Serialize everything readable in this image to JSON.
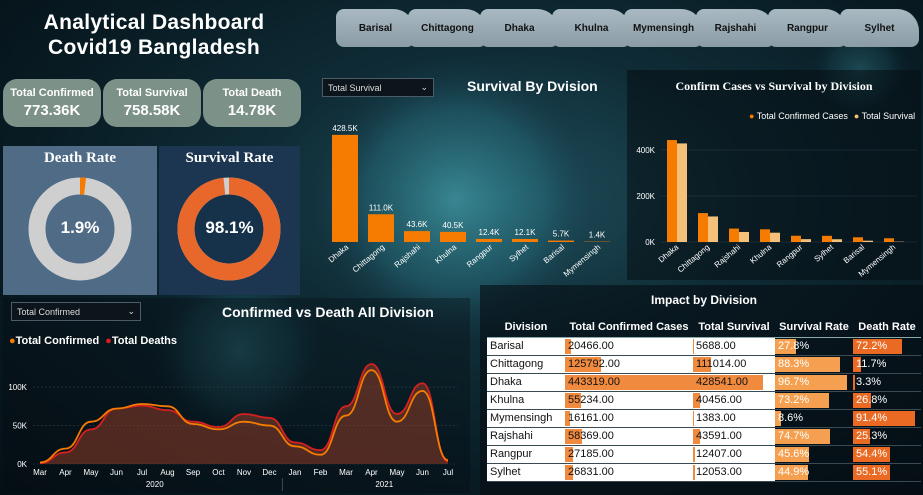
{
  "title": {
    "line1": "Analytical Dashboard",
    "line2": "Covid19 Bangladesh"
  },
  "tabs": [
    "Barisal",
    "Chittagong",
    "Dhaka",
    "Khulna",
    "Mymensingh",
    "Rajshahi",
    "Rangpur",
    "Sylhet"
  ],
  "kpis": [
    {
      "label": "Total Confirmed",
      "value": "773.36K"
    },
    {
      "label": "Total Survival",
      "value": "758.58K"
    },
    {
      "label": "Total Death",
      "value": "14.78K"
    }
  ],
  "gauges": [
    {
      "title": "Death Rate",
      "value": "1.9%",
      "fraction": 0.019
    },
    {
      "title": "Survival Rate",
      "value": "98.1%",
      "fraction": 0.981
    }
  ],
  "colors": {
    "orange": "#f57c00",
    "light_orange": "#f5c07a",
    "red": "#d62020",
    "gauge_bg": "#cfcfcf"
  },
  "survival_chart": {
    "slicer": "Total Survival",
    "title": "Survival By Dvision",
    "chart_data": {
      "type": "bar",
      "categories": [
        "Dhaka",
        "Chittagong",
        "Rajshahi",
        "Khulna",
        "Rangpur",
        "Sylhet",
        "Barisal",
        "Mymensingh"
      ],
      "values": [
        428.5,
        111.0,
        43.6,
        40.5,
        12.4,
        12.1,
        5.7,
        1.4
      ],
      "labels": [
        "428.5K",
        "111.0K",
        "43.6K",
        "40.5K",
        "12.4K",
        "12.1K",
        "5.7K",
        "1.4K"
      ],
      "ylim": [
        0,
        440
      ]
    }
  },
  "confirm_survival_chart": {
    "title": "Confirm Cases vs Survival by Division",
    "chart_data": {
      "type": "bar",
      "categories": [
        "Dhaka",
        "Chittagong",
        "Rajshahi",
        "Khulna",
        "Rangpur",
        "Sylhet",
        "Barisal",
        "Mymensingh"
      ],
      "series": [
        {
          "name": "Total Confirmed Cases",
          "values": [
            443319,
            125792,
            58369,
            55234,
            27185,
            26831,
            20466,
            16161
          ]
        },
        {
          "name": "Total Survival",
          "values": [
            428541,
            111014,
            43591,
            40456,
            12407,
            12053,
            5688,
            1383
          ]
        }
      ],
      "yticks": [
        "0K",
        "200K",
        "400K"
      ],
      "ylim": [
        0,
        500000
      ]
    }
  },
  "line_chart": {
    "slicer": "Total Confirmed",
    "title": "Confirmed vs Death All Division",
    "chart_data": {
      "type": "line",
      "x": [
        "Mar",
        "Apr",
        "May",
        "Jun",
        "Jul",
        "Aug",
        "Sep",
        "Oct",
        "Nov",
        "Dec",
        "Jan",
        "Feb",
        "Mar",
        "Apr",
        "May",
        "Jun",
        "Jul"
      ],
      "year_labels": [
        "2020",
        "2021"
      ],
      "yticks": [
        "0K",
        "50K",
        "100K"
      ],
      "ylim": [
        0,
        130000
      ],
      "series": [
        {
          "name": "Total Confirmed",
          "values": [
            2000,
            20000,
            55000,
            72000,
            78000,
            75000,
            52000,
            45000,
            55000,
            50000,
            23000,
            12000,
            63000,
            122000,
            55000,
            95000,
            5000
          ]
        },
        {
          "name": "Total Deaths",
          "values": [
            1000,
            15000,
            45000,
            72000,
            76000,
            70000,
            55000,
            48000,
            65000,
            60000,
            28000,
            18000,
            75000,
            130000,
            65000,
            105000,
            3000
          ]
        }
      ]
    }
  },
  "impact_table": {
    "title": "Impact by Division",
    "headers": [
      "Division",
      "Total Confirmed Cases",
      "Total Survival",
      "Survival Rate",
      "Death Rate"
    ],
    "rows": [
      {
        "division": "Barisal",
        "confirmed": "20466.00",
        "survival": "5688.00",
        "survival_rate": "27.8%",
        "death_rate": "72.2%",
        "c": 20466,
        "s": 5688,
        "sr": 27.8,
        "dr": 72.2
      },
      {
        "division": "Chittagong",
        "confirmed": "125792.00",
        "survival": "111014.00",
        "survival_rate": "88.3%",
        "death_rate": "11.7%",
        "c": 125792,
        "s": 111014,
        "sr": 88.3,
        "dr": 11.7
      },
      {
        "division": "Dhaka",
        "confirmed": "443319.00",
        "survival": "428541.00",
        "survival_rate": "96.7%",
        "death_rate": "3.3%",
        "c": 443319,
        "s": 428541,
        "sr": 96.7,
        "dr": 3.3
      },
      {
        "division": "Khulna",
        "confirmed": "55234.00",
        "survival": "40456.00",
        "survival_rate": "73.2%",
        "death_rate": "26.8%",
        "c": 55234,
        "s": 40456,
        "sr": 73.2,
        "dr": 26.8
      },
      {
        "division": "Mymensingh",
        "confirmed": "16161.00",
        "survival": "1383.00",
        "survival_rate": "8.6%",
        "death_rate": "91.4%",
        "c": 16161,
        "s": 1383,
        "sr": 8.6,
        "dr": 91.4
      },
      {
        "division": "Rajshahi",
        "confirmed": "58369.00",
        "survival": "43591.00",
        "survival_rate": "74.7%",
        "death_rate": "25.3%",
        "c": 58369,
        "s": 43591,
        "sr": 74.7,
        "dr": 25.3
      },
      {
        "division": "Rangpur",
        "confirmed": "27185.00",
        "survival": "12407.00",
        "survival_rate": "45.6%",
        "death_rate": "54.4%",
        "c": 27185,
        "s": 12407,
        "sr": 45.6,
        "dr": 54.4
      },
      {
        "division": "Sylhet",
        "confirmed": "26831.00",
        "survival": "12053.00",
        "survival_rate": "44.9%",
        "death_rate": "55.1%",
        "c": 26831,
        "s": 12053,
        "sr": 44.9,
        "dr": 55.1
      }
    ]
  }
}
